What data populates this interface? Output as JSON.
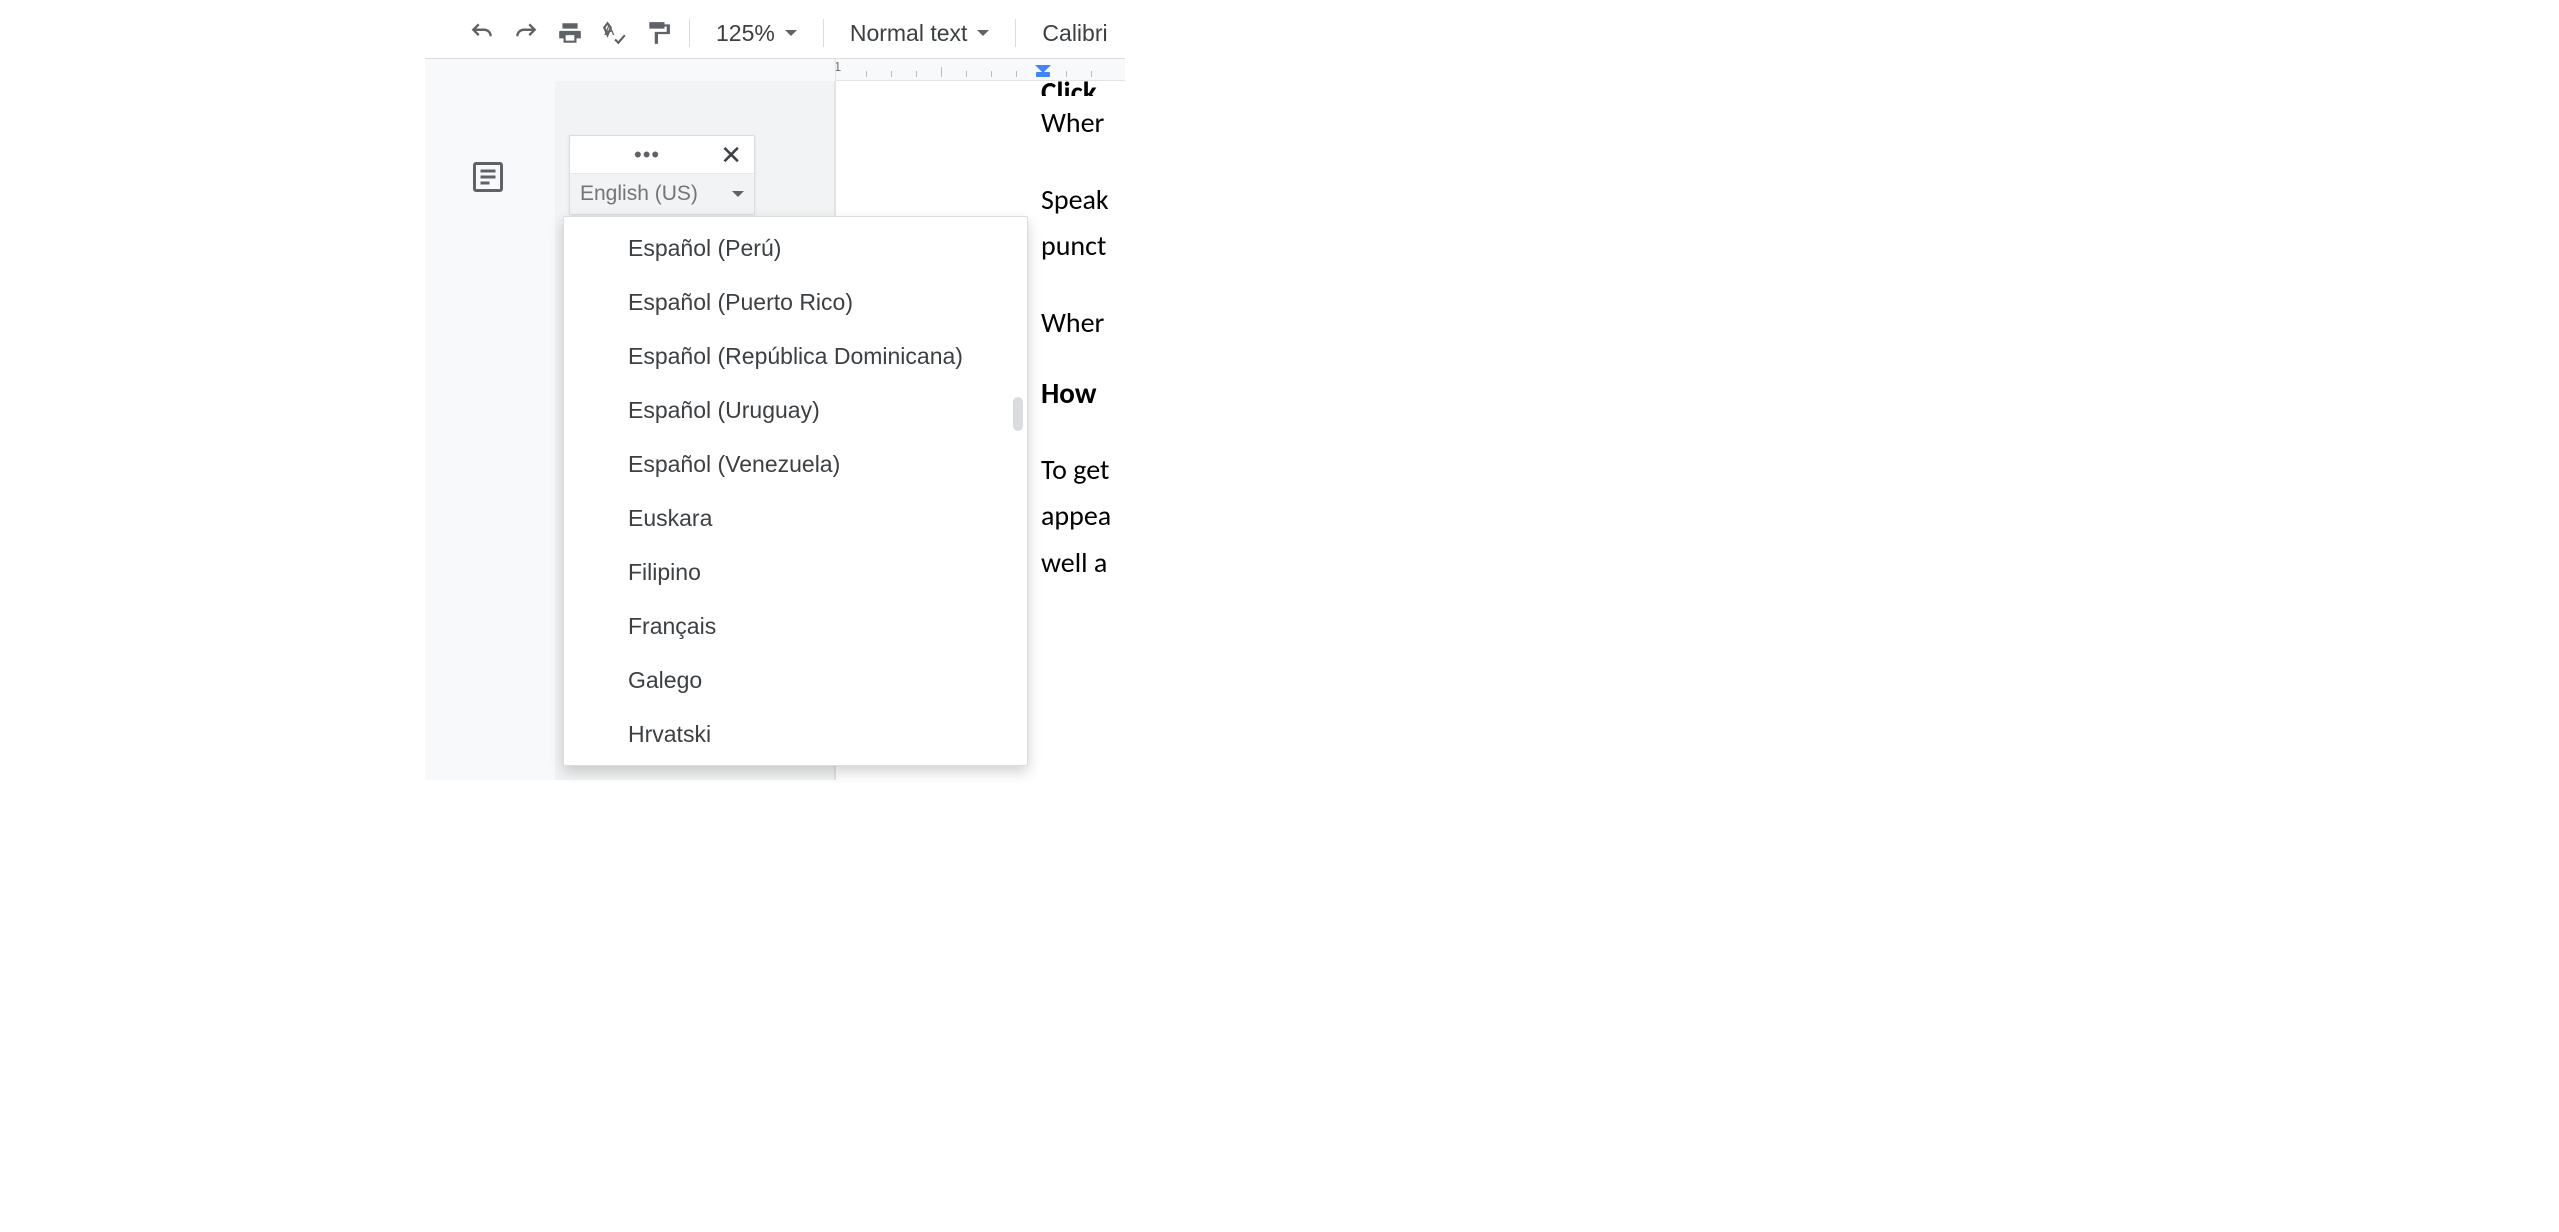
{
  "toolbar": {
    "zoom": "125%",
    "style": "Normal text",
    "font": "Calibri"
  },
  "ruler": {
    "number": "1"
  },
  "voice_typing": {
    "selected_language": "English (US)",
    "options": [
      "Español (Perú)",
      "Español (Puerto Rico)",
      "Español (República Dominicana)",
      "Español (Uruguay)",
      "Español (Venezuela)",
      "Euskara",
      "Filipino",
      "Français",
      "Galego",
      "Hrvatski"
    ]
  },
  "document": {
    "clipped_top": "Click",
    "lines": [
      {
        "kind": "para",
        "text": "Wher"
      },
      {
        "kind": "gap"
      },
      {
        "kind": "para",
        "text": "Speak"
      },
      {
        "kind": "para",
        "text": "punct"
      },
      {
        "kind": "gap"
      },
      {
        "kind": "para",
        "text": "Wher"
      },
      {
        "kind": "gap"
      },
      {
        "kind": "hdr",
        "text": "How"
      },
      {
        "kind": "gap"
      },
      {
        "kind": "para",
        "text": "To get"
      },
      {
        "kind": "para",
        "text": "appea"
      },
      {
        "kind": "para",
        "text": "well a"
      }
    ]
  }
}
